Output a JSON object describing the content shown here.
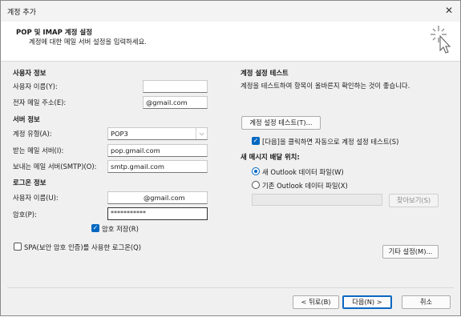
{
  "window": {
    "title": "계정 추가",
    "close_icon": "close-icon"
  },
  "header": {
    "title": "POP 및 IMAP 계정 설정",
    "subtitle": "계정에 대한 메일 서버 설정을 입력하세요."
  },
  "user_info": {
    "heading": "사용자 정보",
    "name_label": "사용자 이름(Y):",
    "name_value": "",
    "email_label": "전자 메일 주소(E):",
    "email_value": "@gmail.com"
  },
  "server_info": {
    "heading": "서버 정보",
    "account_type_label": "계정 유형(A):",
    "account_type_value": "POP3",
    "incoming_label": "받는 메일 서버(I):",
    "incoming_value": "pop.gmail.com",
    "outgoing_label": "보내는 메일 서버(SMTP)(O):",
    "outgoing_value": "smtp.gmail.com"
  },
  "login_info": {
    "heading": "로그온 정보",
    "username_label": "사용자 이름(U):",
    "username_value": "@gmail.com",
    "password_label": "암호(P):",
    "password_value": "***********",
    "remember_label": "암호 저장(R)",
    "remember_checked": true,
    "spa_label": "SPA(보안 암호 인증)를 사용한 로그온(Q)",
    "spa_checked": false
  },
  "test": {
    "heading": "계정 설정 테스트",
    "description": "계정을 테스트하여 항목이 올바른지 확인하는 것이 좋습니다.",
    "test_button": "계정 설정 테스트(T)...",
    "auto_test_label": "[다음]을 클릭하면 자동으로 계정 설정 테스트(S)",
    "auto_test_checked": true
  },
  "delivery": {
    "heading": "새 메시지 배달 위치:",
    "new_file_label": "새 Outlook 데이터 파일(W)",
    "existing_file_label": "기존 Outlook 데이터 파일(X)",
    "existing_file_value": "",
    "browse_button": "찾아보기(S)",
    "selected": "new"
  },
  "more_settings_button": "기타 설정(M)...",
  "footer": {
    "back": "< 뒤로(B)",
    "next": "다음(N) >",
    "cancel": "취소"
  }
}
